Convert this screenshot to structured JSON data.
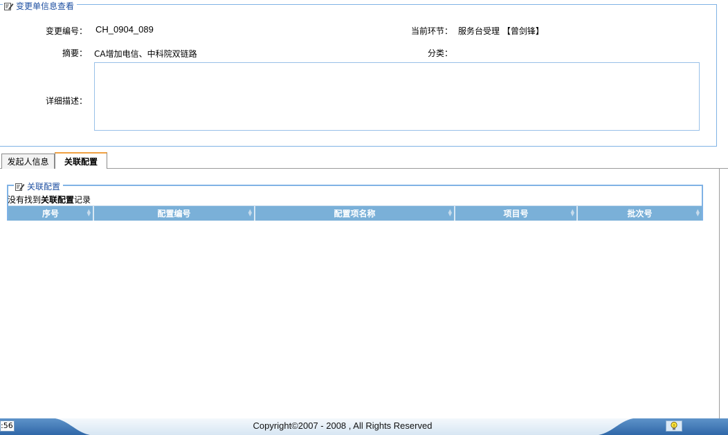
{
  "form": {
    "legend": "变更单信息查看",
    "change_no_label": "变更编号：",
    "change_no_value": "CH_0904_089",
    "current_step_label": "当前环节：",
    "current_step_value": "服务台受理 【曾剑锋】",
    "summary_label": "摘要：",
    "summary_value": "CA增加电信、中科院双链路",
    "category_label": "分类：",
    "detail_label": "详细描述："
  },
  "tabs": [
    {
      "label": "发起人信息",
      "active": false
    },
    {
      "label": "关联配置",
      "active": true
    }
  ],
  "related": {
    "legend": "关联配置",
    "no_record_pre": "没有找到",
    "no_record_bold": "关联配置",
    "no_record_post": "记录",
    "columns": [
      "序号",
      "配置编号",
      "配置项名称",
      "项目号",
      "批次号"
    ]
  },
  "footer": {
    "clock": ":56",
    "copyright": "Copyright©2007 - 2008 , All Rights Reserved"
  },
  "icons": {
    "legend_icon": "edit-icon",
    "bulb": "lightbulb-icon"
  },
  "colors": {
    "border_blue": "#7fb2e5",
    "legend_blue": "#1e4fa1",
    "grid_header": "#7ab0d8",
    "tab_active_top": "#f0a040"
  }
}
